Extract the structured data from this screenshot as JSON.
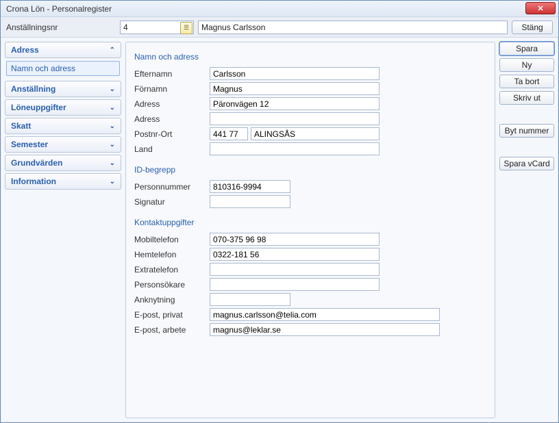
{
  "window": {
    "title": "Crona Lön - Personalregister"
  },
  "topbar": {
    "nr_label": "Anställningsnr",
    "nr_value": "4",
    "name_value": "Magnus Carlsson",
    "close_label": "Stäng"
  },
  "sidebar": {
    "adress": "Adress",
    "adress_sub": "Namn och adress",
    "anstallning": "Anställning",
    "loneuppgifter": "Löneuppgifter",
    "skatt": "Skatt",
    "semester": "Semester",
    "grundvarden": "Grundvärden",
    "information": "Information"
  },
  "sections": {
    "namn": {
      "title": "Namn och adress",
      "efternamn_lbl": "Efternamn",
      "efternamn": "Carlsson",
      "fornamn_lbl": "Förnamn",
      "fornamn": "Magnus",
      "adress_lbl": "Adress",
      "adress": "Päronvägen 12",
      "adress2_lbl": "Adress",
      "adress2": "",
      "postnrort_lbl": "Postnr-Ort",
      "postnr": "441 77",
      "ort": "ALINGSÅS",
      "land_lbl": "Land",
      "land": ""
    },
    "id": {
      "title": "ID-begrepp",
      "personnummer_lbl": "Personnummer",
      "personnummer": "810316-9994",
      "signatur_lbl": "Signatur",
      "signatur": ""
    },
    "kontakt": {
      "title": "Kontaktuppgifter",
      "mobil_lbl": "Mobiltelefon",
      "mobil": "070-375 96 98",
      "hemtel_lbl": "Hemtelefon",
      "hemtel": "0322-181 56",
      "extratel_lbl": "Extratelefon",
      "extratel": "",
      "sokare_lbl": "Personsökare",
      "sokare": "",
      "ankn_lbl": "Anknytning",
      "ankn": "",
      "epost_priv_lbl": "E-post, privat",
      "epost_priv": "magnus.carlsson@telia.com",
      "epost_arb_lbl": "E-post, arbete",
      "epost_arb": "magnus@leklar.se"
    }
  },
  "actions": {
    "spara": "Spara",
    "ny": "Ny",
    "tabort": "Ta bort",
    "skrivut": "Skriv ut",
    "bytnr": "Byt nummer",
    "vcard": "Spara vCard"
  }
}
